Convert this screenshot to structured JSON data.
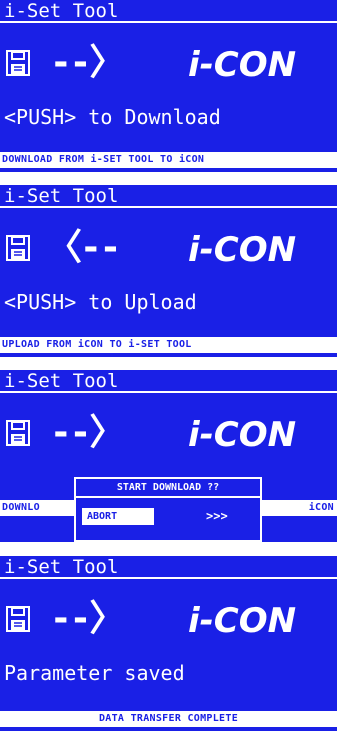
{
  "colors": {
    "screen_bg": "#1a20e6",
    "foreground": "#ffffff"
  },
  "panels": [
    {
      "title": "i-Set Tool",
      "arrow": "--〉",
      "brand": "i-CON",
      "message": "<PUSH> to Download",
      "status": "DOWNLOAD FROM i-SET TOOL TO iCON"
    },
    {
      "title": "i-Set Tool",
      "arrow": "〈--",
      "brand": "i-CON",
      "message": "<PUSH> to Upload",
      "status": "UPLOAD FROM iCON TO i-SET TOOL"
    },
    {
      "title": "i-Set Tool",
      "arrow": "--〉",
      "brand": "i-CON",
      "status_left": "DOWNLO",
      "status_right": "iCON",
      "dialog": {
        "title": "START DOWNLOAD ??",
        "abort": "ABORT",
        "next": ">>>"
      }
    },
    {
      "title": "i-Set Tool",
      "arrow": "--〉",
      "brand": "i-CON",
      "message": "Parameter saved",
      "status": "DATA TRANSFER COMPLETE"
    }
  ],
  "icons": {
    "disk": "floppy-disk-icon",
    "gear": "gear-icon"
  }
}
